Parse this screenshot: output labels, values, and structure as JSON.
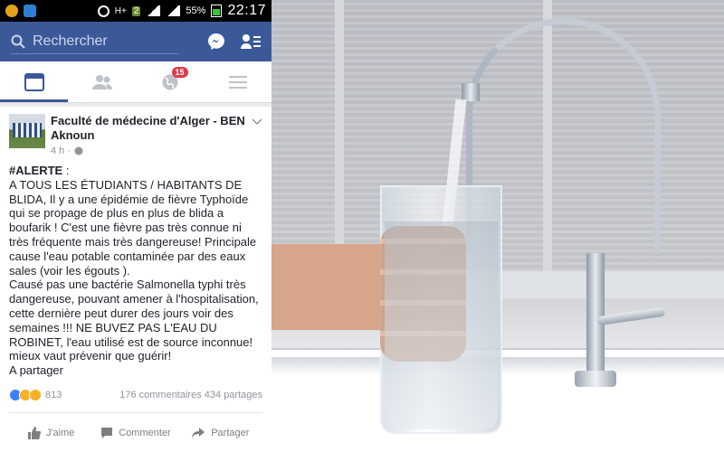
{
  "status_bar": {
    "network": "H+",
    "sim": "2",
    "battery": "55%",
    "time": "22:17"
  },
  "header": {
    "search_placeholder": "Rechercher"
  },
  "tabs": [
    {
      "name": "news-feed",
      "icon": "newsfeed-icon",
      "active": true
    },
    {
      "name": "friends",
      "icon": "friends-icon",
      "active": false
    },
    {
      "name": "notifications",
      "icon": "globe-icon",
      "badge": "15",
      "active": false
    },
    {
      "name": "menu",
      "icon": "menu-icon",
      "active": false
    }
  ],
  "post": {
    "page_name": "Faculté de médecine d'Alger - BEN Aknoun",
    "time": "4 h ·",
    "hashtag": "#ALERTE",
    "hashtag_suffix": " :",
    "paragraph1": "A TOUS LES ÉTUDIANTS / HABITANTS DE BLIDA, Il y a une épidémie de fièvre Typhoïde qui se propage de plus en plus de blida a boufarik ! C'est une fièvre pas très connue ni très fréquente mais très dangereuse! Principale cause l'eau potable contaminée par des eaux sales (voir les égouts ).",
    "paragraph2": "Causé pas une bactérie Salmonella typhi très dangereuse, pouvant amener à l'hospitalisation, cette dernière peut durer des jours voir des semaines !!! NE BUVEZ PAS L'EAU DU ROBINET, l'eau utilisé est de source inconnue! mieux vaut prévenir que guérir!",
    "paragraph3": "A partager",
    "reactions_count": "813",
    "comments": "176 commentaires",
    "shares": "434 partages"
  },
  "actions": {
    "like": "J'aime",
    "comment": "Commenter",
    "share": "Partager"
  },
  "colors": {
    "fb_blue": "#3b5998",
    "badge_red": "#e0394a",
    "like_blue": "#4080ff"
  }
}
